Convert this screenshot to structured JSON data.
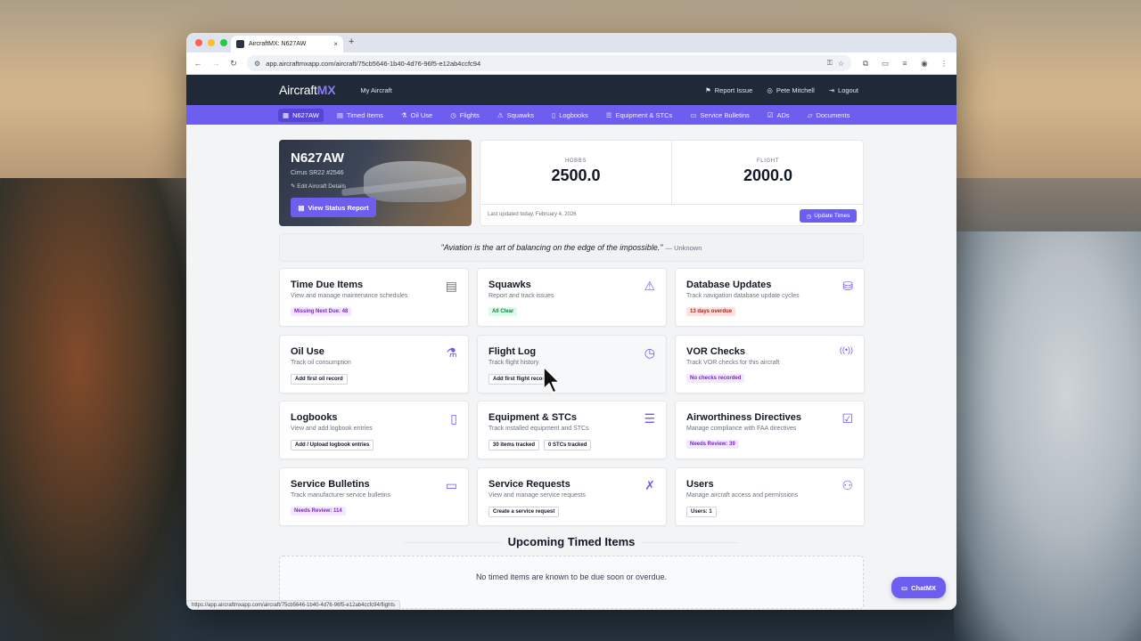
{
  "browser": {
    "tab_title": "AircraftMX: N627AW",
    "tab_close": "×",
    "new_tab": "+",
    "url": "app.aircraftmxapp.com/aircraft/75cb5646-1b40-4d76-96f5-e12ab4ccfc94",
    "status_url": "https://app.aircraftmxapp.com/aircraft/75cb5646-1b40-4d76-96f5-e12ab4ccfc94/flights"
  },
  "topnav": {
    "logo_main": "Aircraft",
    "logo_accent": "MX",
    "my_aircraft": "My Aircraft",
    "report_issue": "Report Issue",
    "user": "Pete Mitchell",
    "logout": "Logout"
  },
  "subnav": [
    {
      "label": "N627AW",
      "icon": "grid-icon"
    },
    {
      "label": "Timed Items",
      "icon": "clipboard-icon"
    },
    {
      "label": "Oil Use",
      "icon": "flask-icon"
    },
    {
      "label": "Flights",
      "icon": "clock-icon"
    },
    {
      "label": "Squawks",
      "icon": "warning-icon"
    },
    {
      "label": "Logbooks",
      "icon": "book-icon"
    },
    {
      "label": "Equipment & STCs",
      "icon": "list-icon"
    },
    {
      "label": "Service Bulletins",
      "icon": "document-icon"
    },
    {
      "label": "ADs",
      "icon": "document-check-icon"
    },
    {
      "label": "Documents",
      "icon": "folder-icon"
    }
  ],
  "aircraft": {
    "registration": "N627AW",
    "model": "Cirrus SR22 #2546",
    "edit_link": "Edit Aircraft Details",
    "status_button": "View Status Report"
  },
  "times": {
    "hobbs_label": "HOBBS",
    "hobbs_value": "2500.0",
    "flight_label": "FLIGHT",
    "flight_value": "2000.0",
    "last_updated": "Last updated today, February 4, 2026",
    "update_button": "Update Times"
  },
  "quote": {
    "text": "\"Aviation is the art of balancing on the edge of the impossible.\"",
    "author": "— Unknown"
  },
  "cards": [
    {
      "title": "Time Due Items",
      "desc": "View and manage maintenance schedules",
      "icon": "clipboard-icon",
      "badges": [
        {
          "text": "Missing Next Due: 48",
          "style": "purple"
        }
      ]
    },
    {
      "title": "Squawks",
      "desc": "Report and track issues",
      "icon": "warning-icon",
      "badges": [
        {
          "text": "All Clear",
          "style": "green"
        }
      ]
    },
    {
      "title": "Database Updates",
      "desc": "Track navigation database update cycles",
      "icon": "database-icon",
      "badges": [
        {
          "text": "13 days overdue",
          "style": "red"
        }
      ]
    },
    {
      "title": "Oil Use",
      "desc": "Track oil consumption",
      "icon": "flask-icon",
      "badges": [
        {
          "text": "Add first oil record",
          "style": "outline"
        }
      ]
    },
    {
      "title": "Flight Log",
      "desc": "Track flight history",
      "icon": "clock-icon",
      "badges": [
        {
          "text": "Add first flight record",
          "style": "outline"
        }
      ]
    },
    {
      "title": "VOR Checks",
      "desc": "Track VOR checks for this aircraft",
      "icon": "radio-signal-icon",
      "badges": [
        {
          "text": "No checks recorded",
          "style": "purple"
        }
      ]
    },
    {
      "title": "Logbooks",
      "desc": "View and add logbook entries",
      "icon": "book-icon",
      "badges": [
        {
          "text": "Add / Upload logbook entries",
          "style": "outline"
        }
      ]
    },
    {
      "title": "Equipment & STCs",
      "desc": "Track installed equipment and STCs",
      "icon": "list-icon",
      "badges": [
        {
          "text": "30 items tracked",
          "style": "outline"
        },
        {
          "text": "0 STCs tracked",
          "style": "outline"
        }
      ]
    },
    {
      "title": "Airworthiness Directives",
      "desc": "Manage compliance with FAA directives",
      "icon": "document-check-icon",
      "badges": [
        {
          "text": "Needs Review: 39",
          "style": "purple"
        }
      ]
    },
    {
      "title": "Service Bulletins",
      "desc": "Track manufacturer service bulletins",
      "icon": "document-icon",
      "badges": [
        {
          "text": "Needs Review: 114",
          "style": "purple"
        }
      ]
    },
    {
      "title": "Service Requests",
      "desc": "View and manage service requests",
      "icon": "tools-icon",
      "badges": [
        {
          "text": "Create a service request",
          "style": "outline"
        }
      ]
    },
    {
      "title": "Users",
      "desc": "Manage aircraft access and permissions",
      "icon": "users-icon",
      "badges": [
        {
          "text": "Users: 1",
          "style": "outline"
        }
      ]
    }
  ],
  "upcoming": {
    "heading": "Upcoming Timed Items",
    "empty": "No timed items are known to be due soon or overdue."
  },
  "chat": {
    "label": "ChatMX"
  },
  "colors": {
    "accent": "#6d5ef0",
    "nav": "#1f2937"
  }
}
